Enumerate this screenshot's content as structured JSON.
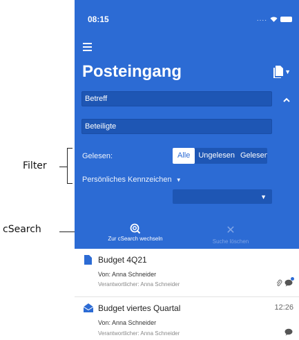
{
  "annotations": {
    "filter": "Filter",
    "csearch": "cSearch"
  },
  "status": {
    "time": "08:15",
    "dots": "....",
    "wifi_icon": "wifi-icon",
    "battery_icon": "battery-icon"
  },
  "header": {
    "title": "Posteingang",
    "menu_icon": "hamburger-icon",
    "doc_icon": "document-icon"
  },
  "filters": {
    "subject_placeholder": "Betreff",
    "participants_placeholder": "Beteiligte",
    "read_label": "Gelesen:",
    "read_options": [
      "Alle",
      "Ungelesen",
      "Gelesen"
    ],
    "read_selected": "Alle",
    "tag_label": "Persönliches Kennzeichen",
    "tag_value": ""
  },
  "toolbar": {
    "switch_label": "Zur cSearch wechseln",
    "clear_label": "Suche löschen"
  },
  "messages": [
    {
      "subject": "Budget 4Q21",
      "from": "Von: Anna Schneider",
      "responsible": "Verantwortlicher: Anna Schneider",
      "time": "",
      "read": true
    },
    {
      "subject": "Budget viertes Quartal",
      "from": "Von: Anna Schneider",
      "responsible": "Verantwortlicher: Anna Schneider",
      "time": "12:26",
      "read": false
    }
  ],
  "colors": {
    "primary": "#2c6bd4",
    "field": "#1e56b4"
  }
}
